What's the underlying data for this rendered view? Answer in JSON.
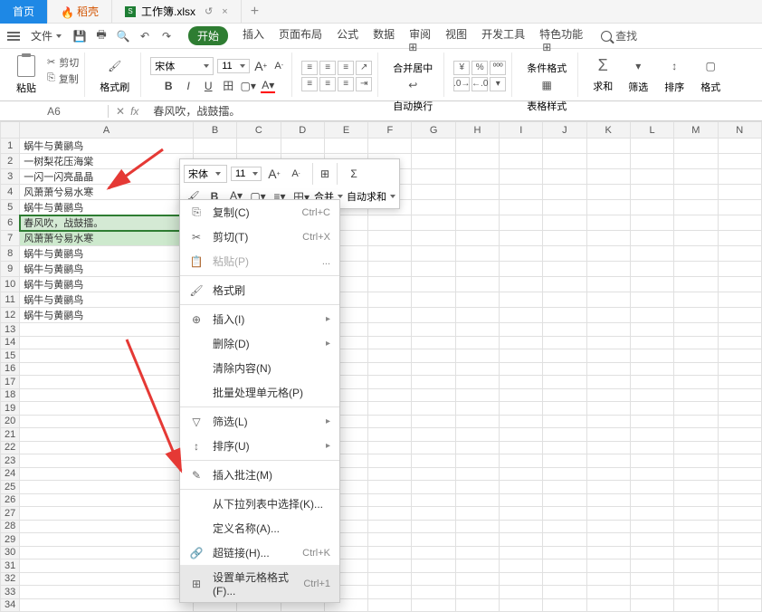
{
  "titleTabs": {
    "tab1": "首页",
    "tab2": "稻壳",
    "tab3": "工作簿.xlsx"
  },
  "menuBar": {
    "file": "文件",
    "tabs": [
      "开始",
      "插入",
      "页面布局",
      "公式",
      "数据",
      "审阅",
      "视图",
      "开发工具",
      "特色功能"
    ],
    "search": "查找"
  },
  "ribbon": {
    "paste": "粘贴",
    "cut": "剪切",
    "copy": "复制",
    "formatPainter": "格式刷",
    "fontName": "宋体",
    "fontSize": "11",
    "increase": "A",
    "decrease": "A",
    "bold": "B",
    "italic": "I",
    "underline": "U",
    "mergeCenter": "合并居中",
    "autoWrap": "自动换行",
    "condFormat": "条件格式",
    "tableStyle": "表格样式",
    "sum": "求和",
    "filter": "筛选",
    "sort": "排序",
    "format": "格式"
  },
  "formulaBar": {
    "cellRef": "A6",
    "fx": "fx",
    "value": "春风吹，战鼓擂。"
  },
  "columns": [
    "A",
    "B",
    "C",
    "D",
    "E",
    "F",
    "G",
    "H",
    "I",
    "J",
    "K",
    "L",
    "M",
    "N"
  ],
  "rows": {
    "1": "蜗牛与黄鹂鸟",
    "2": "一树梨花压海棠",
    "3": "一闪一闪亮晶晶",
    "4": "风萧萧兮易水寒",
    "5": "蜗牛与黄鹂鸟",
    "6": "春风吹，战鼓擂。",
    "7": "风萧萧兮易水寒",
    "8": "蜗牛与黄鹂鸟",
    "9": "蜗牛与黄鹂鸟",
    "10": "蜗牛与黄鹂鸟",
    "11": "蜗牛与黄鹂鸟",
    "12": "蜗牛与黄鹂鸟"
  },
  "miniToolbar": {
    "fontName": "宋体",
    "fontSize": "11",
    "merge": "合并",
    "autoSum": "自动求和"
  },
  "contextMenu": {
    "copy": "复制(C)",
    "cut": "剪切(T)",
    "paste": "粘贴(P)",
    "formatBrush": "格式刷",
    "insert": "插入(I)",
    "delete": "删除(D)",
    "clearContent": "清除内容(N)",
    "batchProcess": "批量处理单元格(P)",
    "filter": "筛选(L)",
    "sort": "排序(U)",
    "insertComment": "插入批注(M)",
    "fromDropdown": "从下拉列表中选择(K)...",
    "defineName": "定义名称(A)...",
    "hyperlink": "超链接(H)...",
    "cellFormat": "设置单元格格式(F)...",
    "shortcutCopy": "Ctrl+C",
    "shortcutCut": "Ctrl+X",
    "shortcutHyper": "Ctrl+K",
    "shortcutFormat": "Ctrl+1",
    "more": "..."
  }
}
